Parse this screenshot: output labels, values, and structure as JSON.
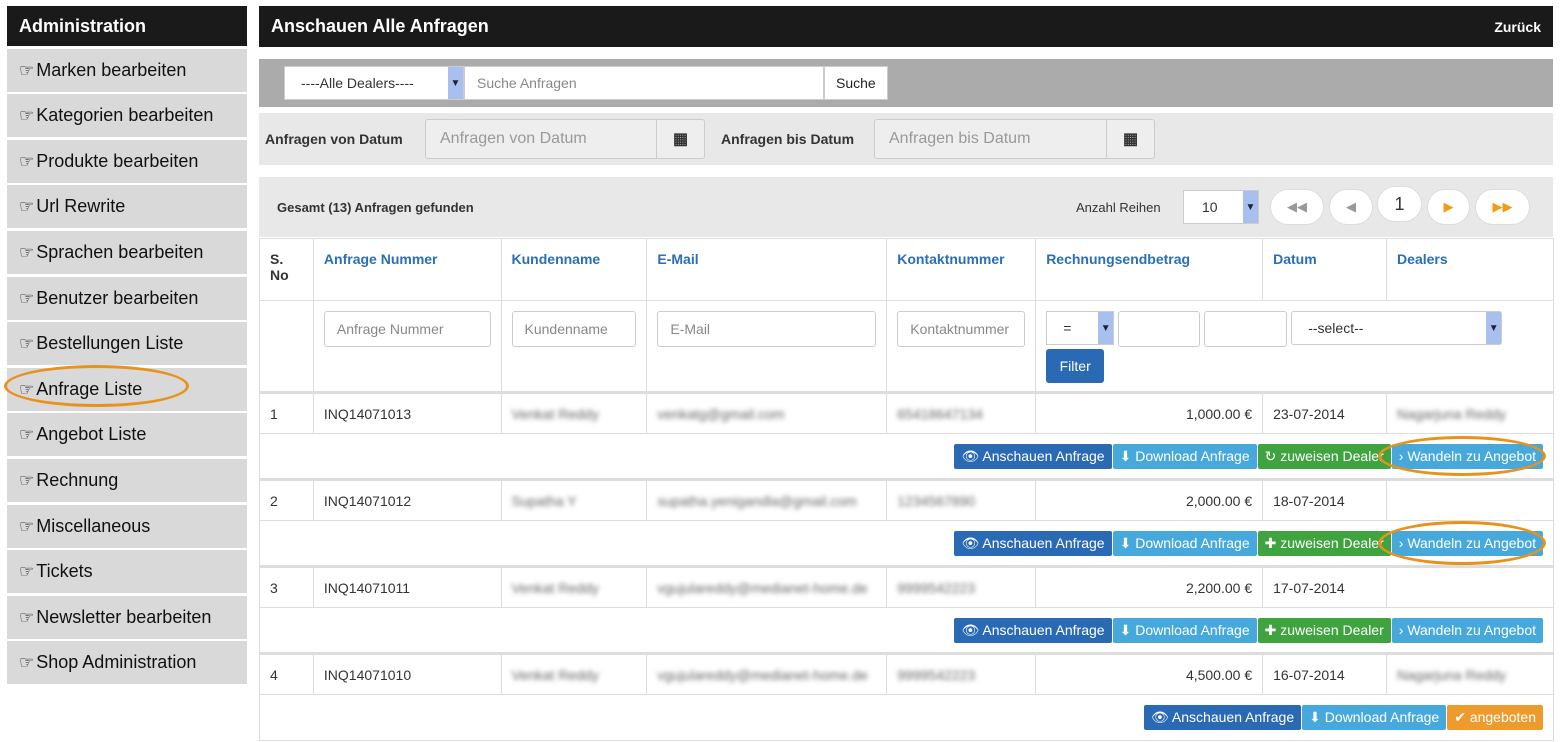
{
  "sidebar": {
    "title": "Administration",
    "items": [
      {
        "label": "Marken bearbeiten"
      },
      {
        "label": "Kategorien bearbeiten"
      },
      {
        "label": "Produkte bearbeiten"
      },
      {
        "label": "Url Rewrite"
      },
      {
        "label": "Sprachen bearbeiten"
      },
      {
        "label": "Benutzer bearbeiten"
      },
      {
        "label": "Bestellungen Liste"
      },
      {
        "label": "Anfrage Liste",
        "highlighted": true
      },
      {
        "label": "Angebot Liste"
      },
      {
        "label": "Rechnung"
      },
      {
        "label": "Miscellaneous"
      },
      {
        "label": "Tickets"
      },
      {
        "label": "Newsletter bearbeiten"
      },
      {
        "label": "Shop Administration"
      }
    ],
    "icon": "hand-pointing-right-icon"
  },
  "header": {
    "title": "Anschauen Alle Anfragen",
    "back": "Zurück"
  },
  "search": {
    "dealer_select": "----Alle Dealers----",
    "placeholder": "Suche Anfragen",
    "button": "Suche"
  },
  "dates": {
    "from_label": "Anfragen von Datum",
    "from_placeholder": "Anfragen von Datum",
    "to_label": "Anfragen bis Datum",
    "to_placeholder": "Anfragen bis Datum"
  },
  "summary": {
    "text": "Gesamt (13) Anfragen gefunden",
    "rows_label": "Anzahl Reihen",
    "rows_value": "10",
    "page": "1"
  },
  "table": {
    "headers": [
      "S. No",
      "Anfrage Nummer",
      "Kundenname",
      "E-Mail",
      "Kontaktnummer",
      "Rechnungsendbetrag",
      "Datum",
      "Dealers"
    ],
    "filters": {
      "nummer": "Anfrage Nummer",
      "kunde": "Kundenname",
      "email": "E-Mail",
      "kontakt": "Kontaktnummer",
      "op": "=",
      "dealer": "--select--",
      "button": "Filter"
    },
    "rows": [
      {
        "no": "1",
        "nummer": "INQ14071013",
        "kunde": "Venkat Reddy",
        "email": "venkatg@gmail.com",
        "kontakt": "65418647134",
        "betrag": "1,000.00 €",
        "datum": "23-07-2014",
        "dealer": "Nagarjuna Reddy",
        "actions": [
          "Anschauen Anfrage",
          "Download Anfrage",
          "zuweisen Dealer",
          "Wandeln zu Angebot"
        ]
      },
      {
        "no": "2",
        "nummer": "INQ14071012",
        "kunde": "Supatha Y",
        "email": "supatha.yenigandla@gmail.com",
        "kontakt": "1234567890",
        "betrag": "2,000.00 €",
        "datum": "18-07-2014",
        "dealer": "",
        "actions": [
          "Anschauen Anfrage",
          "Download Anfrage",
          "zuweisen Dealer",
          "Wandeln zu Angebot"
        ]
      },
      {
        "no": "3",
        "nummer": "INQ14071011",
        "kunde": "Venkat Reddy",
        "email": "vgujulareddy@medianet-home.de",
        "kontakt": "9999542223",
        "betrag": "2,200.00 €",
        "datum": "17-07-2014",
        "dealer": "",
        "actions": [
          "Anschauen Anfrage",
          "Download Anfrage",
          "zuweisen Dealer",
          "Wandeln zu Angebot"
        ]
      },
      {
        "no": "4",
        "nummer": "INQ14071010",
        "kunde": "Venkat Reddy",
        "email": "vgujulareddy@medianet-home.de",
        "kontakt": "9999542223",
        "betrag": "4,500.00 €",
        "datum": "16-07-2014",
        "dealer": "Nagarjuna Reddy",
        "actions": [
          "Anschauen Anfrage",
          "Download Anfrage",
          "angeboten"
        ]
      }
    ]
  },
  "colors": {
    "primary": "#2a6ab5",
    "info": "#47a9db",
    "success": "#3fa43f",
    "warning": "#ee9b2e",
    "highlight": "#e8921e"
  }
}
